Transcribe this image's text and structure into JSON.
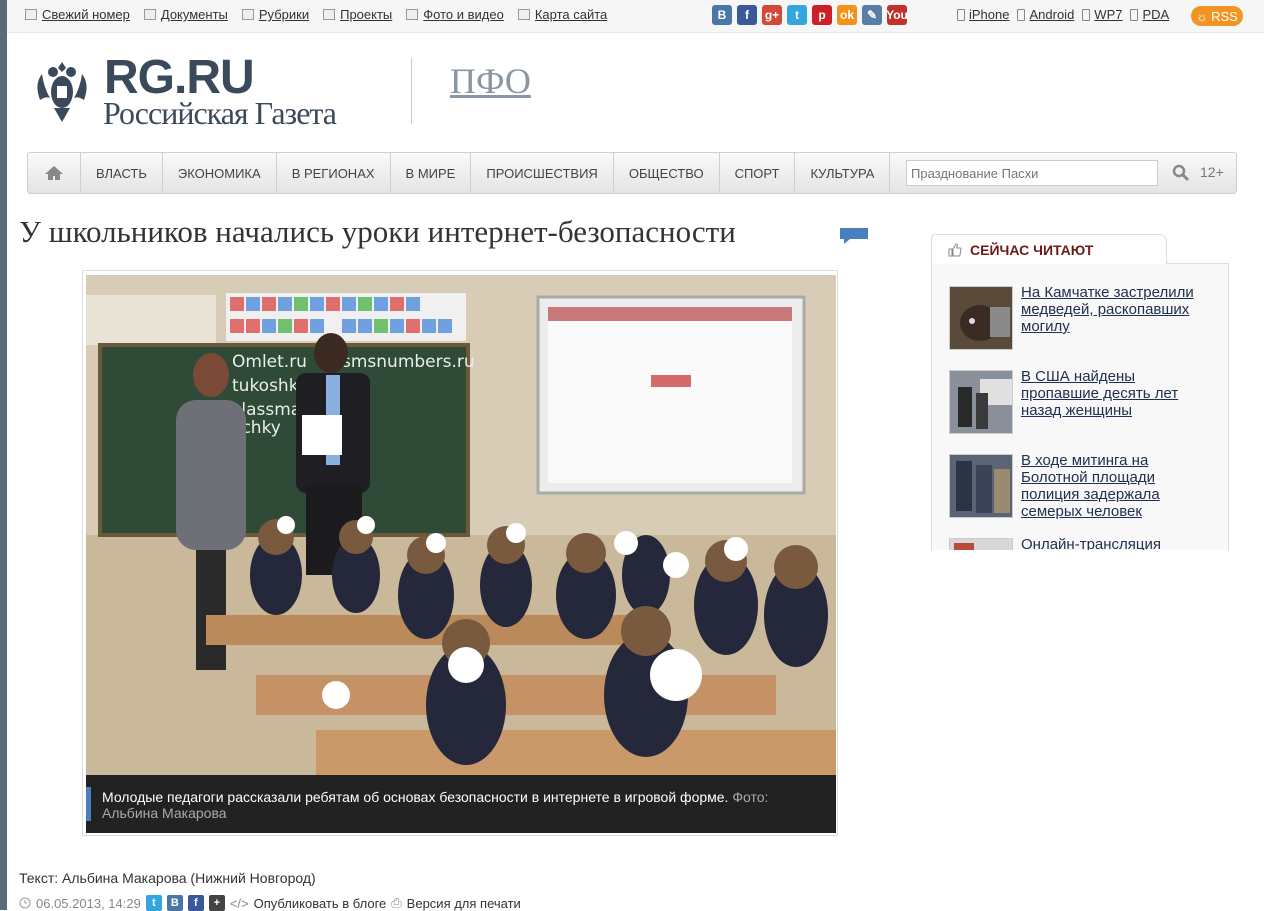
{
  "topbar": {
    "links": [
      "Свежий номер",
      "Документы",
      "Рубрики",
      "Проекты",
      "Фото и видео",
      "Карта сайта"
    ],
    "social": [
      {
        "name": "vk",
        "glyph": "В",
        "color": "#4a76a8"
      },
      {
        "name": "facebook",
        "glyph": "f",
        "color": "#3b5998"
      },
      {
        "name": "google-plus",
        "glyph": "g+",
        "color": "#d34836"
      },
      {
        "name": "twitter",
        "glyph": "t",
        "color": "#33a6de"
      },
      {
        "name": "pinterest",
        "glyph": "p",
        "color": "#cb2027"
      },
      {
        "name": "odnoklassniki",
        "glyph": "ok",
        "color": "#f2931c"
      },
      {
        "name": "livejournal",
        "glyph": "✎",
        "color": "#5a7ca8"
      },
      {
        "name": "youtube",
        "glyph": "You",
        "color": "#c4302b"
      }
    ],
    "mobile": [
      "iPhone",
      "Android",
      "WP7",
      "PDA"
    ],
    "rss": "RSS"
  },
  "header": {
    "logo_top": "RG.RU",
    "logo_name": "Российская Газета",
    "region": "ПФО"
  },
  "nav": {
    "items": [
      "ВЛАСТЬ",
      "ЭКОНОМИКА",
      "В РЕГИОНАХ",
      "В МИРЕ",
      "ПРОИСШЕСТВИЯ",
      "ОБЩЕСТВО",
      "СПОРТ",
      "КУЛЬТУРА"
    ],
    "search_placeholder": "Празднование Пасхи",
    "age": "12+"
  },
  "article": {
    "title": "У школьников начались уроки интернет-безопасности",
    "caption": "Молодые педагоги рассказали ребятам об основах безопасности в интернете в игровой форме.",
    "caption_credit": "Фото: Альбина Макарова",
    "byline_label": "Текст:",
    "author": "Альбина Макарова",
    "location": "Нижний Новгород",
    "date": "06.05.2013, 14:29",
    "blog_link": "Опубликовать в блоге",
    "print_link": "Версия для печати",
    "board_text": [
      "Omlet.ru",
      "smsnumbers.ru",
      "tukoshko.net",
      "classmag.ru",
      "lichky"
    ]
  },
  "sidebar": {
    "title": "СЕЙЧАС ЧИТАЮТ",
    "items": [
      {
        "text": "На Камчатке застрелили медведей, раскопавших могилу",
        "thumb": "#5a4a3a"
      },
      {
        "text": "В США найдены пропавшие десять лет назад женщины",
        "thumb": "#6d7480"
      },
      {
        "text": "В ходе митинга на Болотной площади полиция задержала семерых человек",
        "thumb": "#4c5666"
      },
      {
        "text": "Онлайн-трансляция",
        "thumb": "#b84a3a"
      }
    ]
  }
}
